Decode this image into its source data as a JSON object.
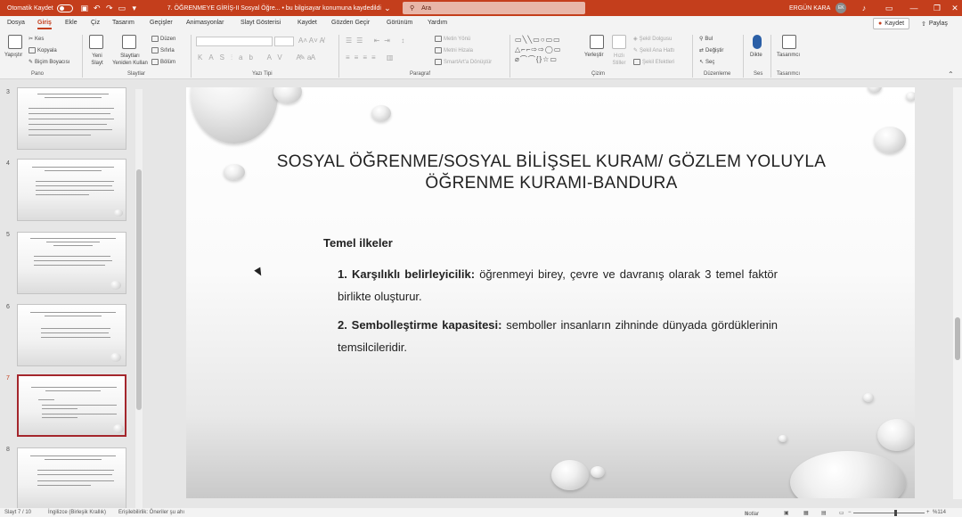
{
  "titlebar": {
    "autosave_label": "Otomatik Kaydet",
    "doc_title": "7. ÖĞRENMEYE GİRİŞ-II Sosyal Öğre... • bu bilgisayar konumuna kaydedildi",
    "search_placeholder": "Ara",
    "user_name": "ERGÜN KARA",
    "user_initials": "EK"
  },
  "menu": {
    "tabs": [
      "Dosya",
      "Giriş",
      "Ekle",
      "Çiz",
      "Tasarım",
      "Geçişler",
      "Animasyonlar",
      "Slayt Gösterisi",
      "Kaydet",
      "Gözden Geçir",
      "Görünüm",
      "Yardım"
    ],
    "active_tab": "Giriş",
    "save_button": "Kaydet",
    "share_button": "Paylaş"
  },
  "ribbon": {
    "clipboard": {
      "paste": "Yapıştır",
      "cut": "Kes",
      "copy": "Kopyala",
      "format_painter": "Biçim Boyacısı",
      "label": "Pano"
    },
    "slides": {
      "new_slide": "Yeni Slayt",
      "reuse": "Slaytları Yeniden Kullan",
      "layout": "Düzen",
      "reset": "Sıfırla",
      "section": "Bölüm",
      "label": "Slaytlar"
    },
    "font": {
      "label": "Yazı Tipi"
    },
    "paragraph": {
      "text_direction": "Metin Yönü",
      "align_text": "Metni Hizala",
      "smartart": "SmartArt'a Dönüştür",
      "label": "Paragraf"
    },
    "drawing": {
      "arrange": "Yerleştir",
      "quick_styles": "Hızlı Stiller",
      "shape_fill": "Şekil Dolgusu",
      "shape_outline": "Şekil Ana Hattı",
      "shape_effects": "Şekil Efektleri",
      "label": "Çizim"
    },
    "editing": {
      "find": "Bul",
      "replace": "Değiştir",
      "select": "Seç",
      "label": "Düzenleme"
    },
    "voice": {
      "dictate": "Dikte",
      "label": "Ses"
    },
    "designer": {
      "designer": "Tasarımcı",
      "label": "Tasarımcı"
    }
  },
  "thumbnails": [
    {
      "num": "3",
      "selected": false
    },
    {
      "num": "4",
      "selected": false
    },
    {
      "num": "5",
      "selected": false
    },
    {
      "num": "6",
      "selected": false
    },
    {
      "num": "7",
      "selected": true
    },
    {
      "num": "8",
      "selected": false
    }
  ],
  "slide": {
    "title_line1": "SOSYAL ÖĞRENME/SOSYAL BİLİŞSEL KURAM/ GÖZLEM YOLUYLA",
    "title_line2": "ÖĞRENME KURAMI-BANDURA",
    "section_heading": "Temel ilkeler",
    "points": [
      {
        "num": "1.",
        "term": "Karşılıklı belirleyicilik:",
        "text": "öğrenmeyi birey, çevre ve davranış olarak 3 temel faktör birlikte oluşturur."
      },
      {
        "num": "2.",
        "term": "Sembolleştirme kapasitesi:",
        "text": "semboller insanların zihninde dünyada gördüklerinin temsilcileridir."
      }
    ]
  },
  "statusbar": {
    "slide_counter": "Slayt 7 / 10",
    "language": "İngilizce (Birleşik Krallık)",
    "accessibility": "Erişilebilirlik: Öneriler şu ahı",
    "notes": "Notlar",
    "zoom": "%114"
  }
}
